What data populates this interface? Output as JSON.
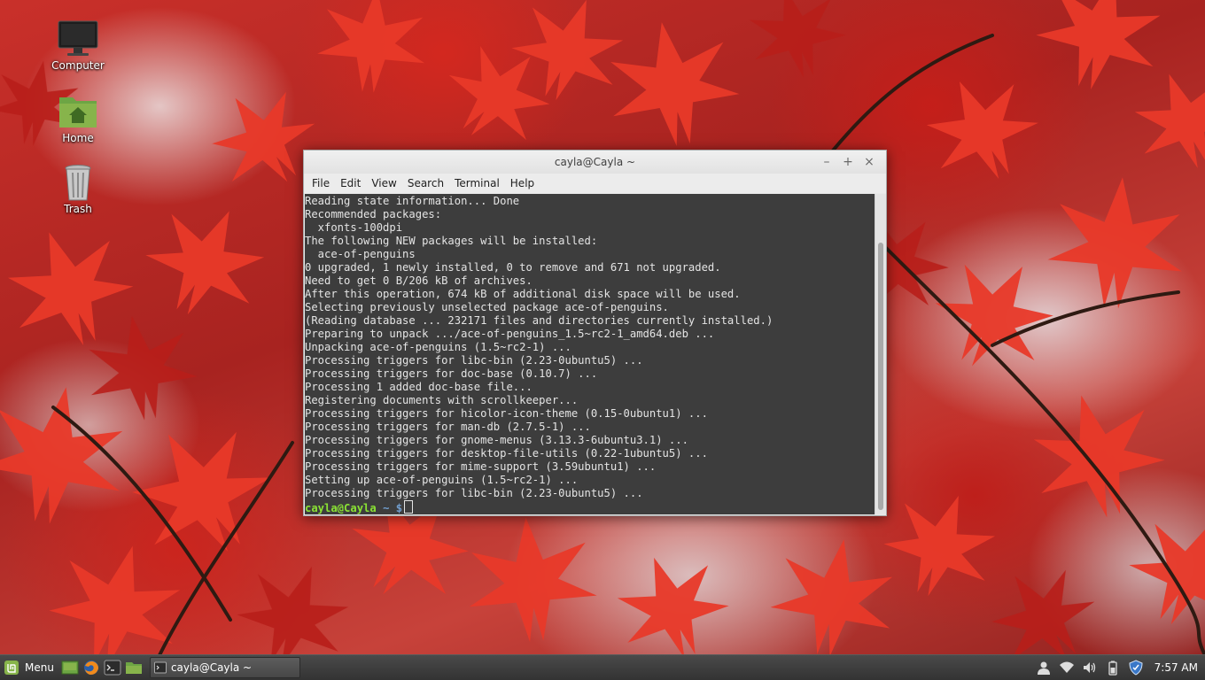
{
  "desktop_icons": [
    {
      "name": "computer",
      "label": "Computer"
    },
    {
      "name": "home",
      "label": "Home"
    },
    {
      "name": "trash",
      "label": "Trash"
    }
  ],
  "window": {
    "title": "cayla@Cayla ~",
    "controls": {
      "minimize": "–",
      "maximize": "+",
      "close": "×"
    },
    "menu": [
      "File",
      "Edit",
      "View",
      "Search",
      "Terminal",
      "Help"
    ]
  },
  "terminal": {
    "lines": [
      "Reading state information... Done",
      "Recommended packages:",
      "  xfonts-100dpi",
      "The following NEW packages will be installed:",
      "  ace-of-penguins",
      "0 upgraded, 1 newly installed, 0 to remove and 671 not upgraded.",
      "Need to get 0 B/206 kB of archives.",
      "After this operation, 674 kB of additional disk space will be used.",
      "Selecting previously unselected package ace-of-penguins.",
      "(Reading database ... 232171 files and directories currently installed.)",
      "Preparing to unpack .../ace-of-penguins_1.5~rc2-1_amd64.deb ...",
      "Unpacking ace-of-penguins (1.5~rc2-1) ...",
      "Processing triggers for libc-bin (2.23-0ubuntu5) ...",
      "Processing triggers for doc-base (0.10.7) ...",
      "Processing 1 added doc-base file...",
      "Registering documents with scrollkeeper...",
      "Processing triggers for hicolor-icon-theme (0.15-0ubuntu1) ...",
      "Processing triggers for man-db (2.7.5-1) ...",
      "Processing triggers for gnome-menus (3.13.3-6ubuntu3.1) ...",
      "Processing triggers for desktop-file-utils (0.22-1ubuntu5) ...",
      "Processing triggers for mime-support (3.59ubuntu1) ...",
      "Setting up ace-of-penguins (1.5~rc2-1) ...",
      "Processing triggers for libc-bin (2.23-0ubuntu5) ..."
    ],
    "prompt": {
      "user_host": "cayla@Cayla",
      "path": "~",
      "symbol": "$"
    }
  },
  "taskbar": {
    "menu_label": "Menu",
    "launchers": [
      "show-desktop-icon",
      "firefox-icon",
      "terminal-icon",
      "files-icon"
    ],
    "task_item": "cayla@Cayla ~",
    "tray_icons": [
      "user-icon",
      "wifi-icon",
      "volume-icon",
      "battery-icon",
      "shield-icon"
    ],
    "clock": "7:57 AM"
  },
  "colors": {
    "terminal_bg": "#3d3d3d",
    "prompt_user": "#8ae234",
    "prompt_path": "#729fcf",
    "mint_green": "#87b44b"
  }
}
